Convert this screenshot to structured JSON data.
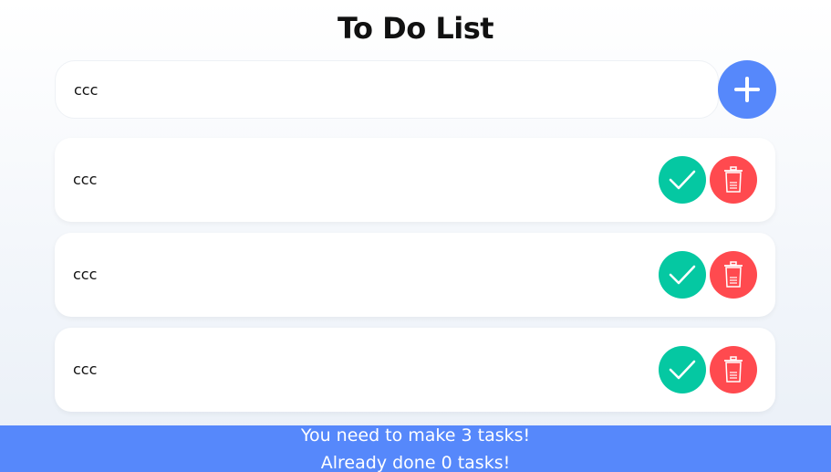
{
  "header": {
    "title": "To Do List"
  },
  "new_task": {
    "value": "ccc"
  },
  "tasks": [
    {
      "text": "ccc"
    },
    {
      "text": "ccc"
    },
    {
      "text": "ccc"
    }
  ],
  "footer": {
    "line1": "You need to make 3 tasks!",
    "line2": "Already done 0 tasks!"
  },
  "icons": {
    "add": "plus-icon",
    "done": "check-icon",
    "delete": "trash-icon"
  },
  "colors": {
    "accent": "#5688fb",
    "done": "#05c8a2",
    "delete": "#ff4a4f"
  }
}
